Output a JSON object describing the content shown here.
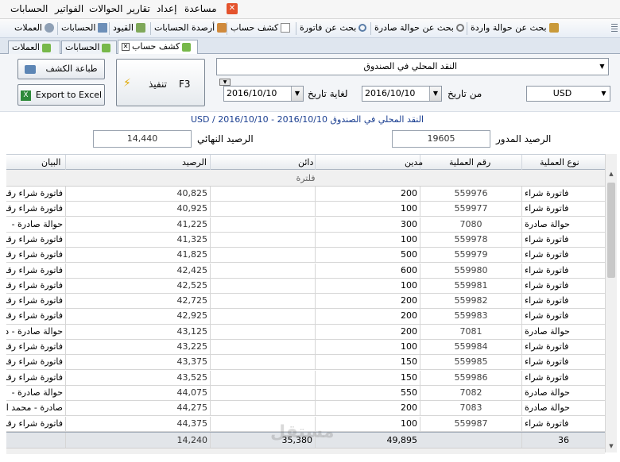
{
  "menu": {
    "items": [
      "مساعدة",
      "إعداد",
      "تقارير",
      "الحوالات",
      "الفواتير",
      "الحسابات"
    ]
  },
  "toolbar": {
    "items": [
      {
        "label": "بحث عن حوالة واردة",
        "icon": "incoming-transfer-search-icon"
      },
      {
        "label": "بحث عن حوالة صادرة",
        "icon": "outgoing-transfer-search-icon"
      },
      {
        "label": "بحث عن فاتورة",
        "icon": "invoice-search-icon"
      },
      {
        "label": "كشف حساب",
        "icon": "statement-icon"
      },
      {
        "label": "أرصدة الحسابات",
        "icon": "balances-icon"
      },
      {
        "label": "القيود",
        "icon": "entries-icon"
      },
      {
        "label": "الحسابات",
        "icon": "accounts-icon"
      },
      {
        "label": "العملات",
        "icon": "currencies-icon"
      }
    ]
  },
  "tabs": [
    {
      "label": "كشف حساب",
      "active": true
    },
    {
      "label": "الحسابات",
      "active": false
    },
    {
      "label": "العملات",
      "active": false
    }
  ],
  "panel": {
    "print_label": "طباعة الكشف",
    "export_label": "Export to Excel",
    "execute_label": "تنفيذ",
    "execute_key": "F3",
    "account": "النقد المحلي في الصندوق",
    "from_label": "من تاريخ",
    "to_label": "لغاية تاريخ",
    "from_date": "2016/10/10",
    "to_date": "2016/10/10",
    "currency": "USD"
  },
  "summary": {
    "line": "USD / النقد المحلي في الصندوق     2016/10/10 - 2016/10/10",
    "carried_label": "الرصيد المدور",
    "carried_value": "19605",
    "final_label": "الرصيد النهائي",
    "final_value": "14,440"
  },
  "grid": {
    "headers": {
      "type": "نوع العملية",
      "number": "رقم العملية",
      "debit": "مدين",
      "credit": "دائن",
      "balance": "الرصيد",
      "description": "البيان"
    },
    "filter_label": "فلترة",
    "rows": [
      {
        "type": "فاتورة شراء",
        "number": "559976",
        "debit": "200",
        "credit": "",
        "balance": "40,825",
        "description": "فاتورة شراء رقم"
      },
      {
        "type": "فاتورة شراء",
        "number": "559977",
        "debit": "100",
        "credit": "",
        "balance": "40,925",
        "description": "فاتورة شراء رقم"
      },
      {
        "type": "حوالة صادرة",
        "number": "7080",
        "debit": "300",
        "credit": "",
        "balance": "41,225",
        "description": "حوالة صادرة -"
      },
      {
        "type": "فاتورة شراء",
        "number": "559978",
        "debit": "100",
        "credit": "",
        "balance": "41,325",
        "description": "فاتورة شراء رقم"
      },
      {
        "type": "فاتورة شراء",
        "number": "559979",
        "debit": "500",
        "credit": "",
        "balance": "41,825",
        "description": "فاتورة شراء رقم"
      },
      {
        "type": "فاتورة شراء",
        "number": "559980",
        "debit": "600",
        "credit": "",
        "balance": "42,425",
        "description": "فاتورة شراء رقم"
      },
      {
        "type": "فاتورة شراء",
        "number": "559981",
        "debit": "100",
        "credit": "",
        "balance": "42,525",
        "description": "فاتورة شراء رقم"
      },
      {
        "type": "فاتورة شراء",
        "number": "559982",
        "debit": "200",
        "credit": "",
        "balance": "42,725",
        "description": "فاتورة شراء رقم"
      },
      {
        "type": "فاتورة شراء",
        "number": "559983",
        "debit": "200",
        "credit": "",
        "balance": "42,925",
        "description": "فاتورة شراء رقم"
      },
      {
        "type": "حوالة صادرة",
        "number": "7081",
        "debit": "200",
        "credit": "",
        "balance": "43,125",
        "description": "حوالة صادرة - د"
      },
      {
        "type": "فاتورة شراء",
        "number": "559984",
        "debit": "100",
        "credit": "",
        "balance": "43,225",
        "description": "فاتورة شراء رقم"
      },
      {
        "type": "فاتورة شراء",
        "number": "559985",
        "debit": "150",
        "credit": "",
        "balance": "43,375",
        "description": "فاتورة شراء رقم"
      },
      {
        "type": "فاتورة شراء",
        "number": "559986",
        "debit": "150",
        "credit": "",
        "balance": "43,525",
        "description": "فاتورة شراء رقم"
      },
      {
        "type": "حوالة صادرة",
        "number": "7082",
        "debit": "550",
        "credit": "",
        "balance": "44,075",
        "description": "حوالة صادرة -"
      },
      {
        "type": "حوالة صادرة",
        "number": "7083",
        "debit": "200",
        "credit": "",
        "balance": "44,275",
        "description": "صادرة - محمد ا"
      },
      {
        "type": "فاتورة شراء",
        "number": "559987",
        "debit": "100",
        "credit": "",
        "balance": "44,375",
        "description": "فاتورة شراء رقم"
      }
    ],
    "footer": {
      "count": "36",
      "debit_total": "49,895",
      "credit_total": "35,380",
      "balance": "14,240"
    }
  },
  "watermark": "مستقل"
}
